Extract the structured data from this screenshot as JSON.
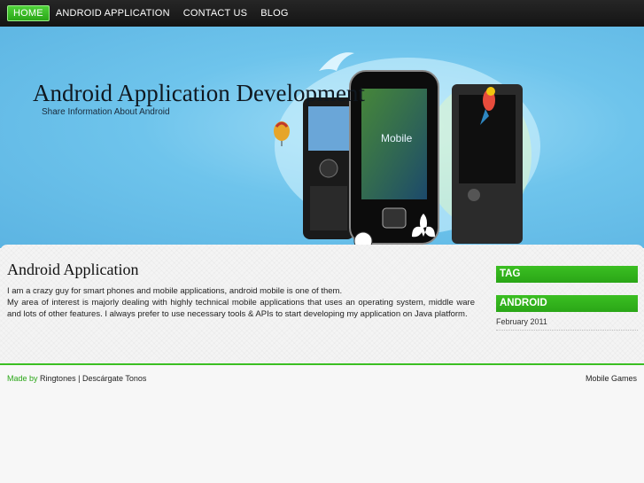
{
  "nav": {
    "items": [
      {
        "label": "HOME",
        "active": true
      },
      {
        "label": "ANDROID APPLICATION",
        "active": false
      },
      {
        "label": "CONTACT US",
        "active": false
      },
      {
        "label": "BLOG",
        "active": false
      }
    ]
  },
  "header": {
    "title": "Android Application Development",
    "tagline": "Share Information About Android",
    "phone_screen_text": "Mobile"
  },
  "post": {
    "title": "Android Application",
    "paragraphs": [
      "I am a crazy guy for smart phones and mobile applications, android mobile is one of them.",
      "My area of interest is majorly dealing with highly technical mobile applications that uses an operating system, middle ware and lots of other features. I always prefer to use necessary tools & APIs to start developing my application on Java platform."
    ]
  },
  "sidebar": {
    "tag_heading": "TAG",
    "android_heading": "ANDROID",
    "archive_link": "February 2011"
  },
  "footer": {
    "made_by": "Made by",
    "link1": "Ringtones",
    "separator": "|",
    "link2": "Descárgate Tonos",
    "right_link": "Mobile Games"
  },
  "colors": {
    "accent_green": "#2aa617",
    "nav_bg": "#1c1c1c",
    "banner_blue": "#6ec4ec"
  }
}
